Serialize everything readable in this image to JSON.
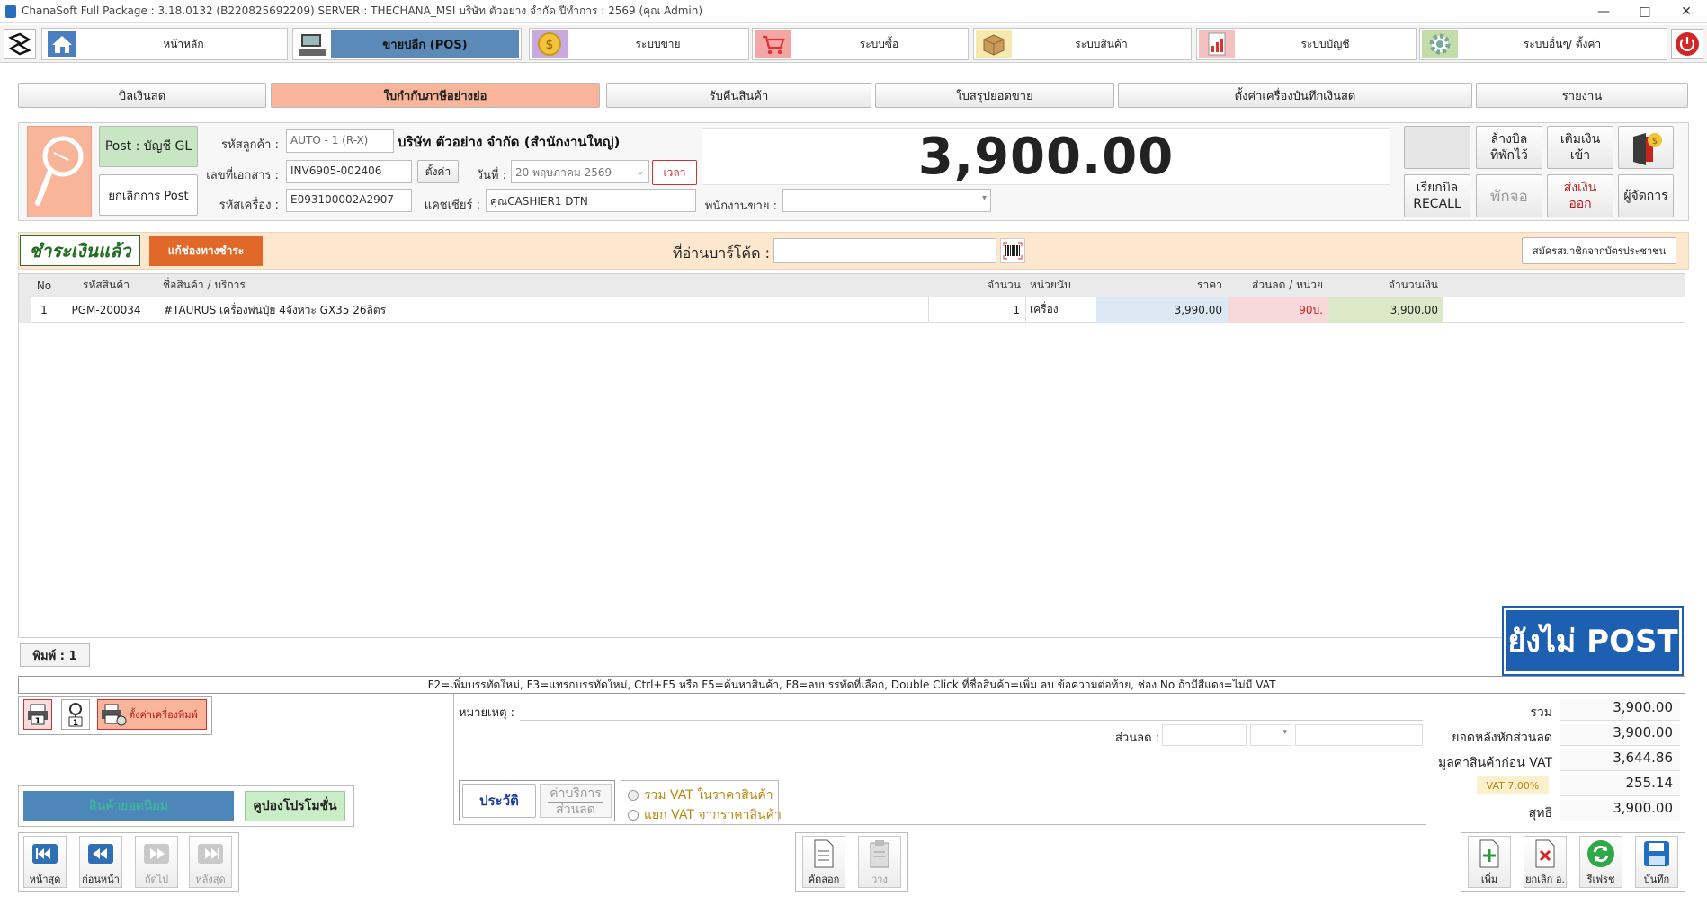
{
  "window": {
    "title": "ChanaSoft Full Package : 3.18.0132 (B220825692209) SERVER : THECHANA_MSI บริษัท ตัวอย่าง จำกัด ปีทำการ : 2569 (คุณ Admin)",
    "controls": [
      "—",
      "□",
      "✕"
    ]
  },
  "menu": {
    "items": [
      {
        "label": "หน้าหลัก",
        "icon": "home-icon"
      },
      {
        "label": "ขายปลีก (POS)",
        "icon": "pos-terminal-icon",
        "active": true
      },
      {
        "label": "ระบบขาย",
        "icon": "coin-icon"
      },
      {
        "label": "ระบบซื้อ",
        "icon": "cart-icon"
      },
      {
        "label": "ระบบสินค้า",
        "icon": "box-icon"
      },
      {
        "label": "ระบบบัญชี",
        "icon": "report-icon"
      },
      {
        "label": "ระบบอื่นๆ/ ตั้งค่า",
        "icon": "gear-icon"
      }
    ]
  },
  "subnav": {
    "tabs": [
      "บิลเงินสด",
      "ใบกำกับภาษีอย่างย่อ",
      "รับคืนสินค้า",
      "ใบสรุปยอดขาย",
      "ตั้งค่าเครื่องบันทึกเงินสด",
      "รายงาน"
    ],
    "active_index": 1
  },
  "header": {
    "post_gl": "Post : บัญชี GL",
    "cancel_post": "ยกเลิกการ Post",
    "customer_label": "รหัสลูกค้า :",
    "customer_code": "AUTO - 1 (R-X)",
    "customer_name": "บริษัท ตัวอย่าง จำกัด (สำนักงานใหญ่)",
    "doc_label": "เลขที่เอกสาร :",
    "doc_no": "INV6905-002406",
    "set_btn": "ตั้งค่า",
    "date_label": "วันที่ :",
    "date_value": "20  พฤษภาคม   2569",
    "time_btn": "เวลา",
    "machine_label": "รหัสเครื่อง :",
    "machine_code": "E093100002A2907",
    "cashier_label": "แคชเชียร์ :",
    "cashier_value": "คุณCASHIER1 DTN",
    "sales_label": "พนักงานขาย :",
    "sales_value": "",
    "total": "3,900.00"
  },
  "right_buttons": {
    "clear_held": "ล้างบิล\nที่พักไว้",
    "cash_in": "เติมเงิน\nเข้า",
    "recall": "เรียกบิล\nRECALL",
    "hold": "พักจอ",
    "cash_out": "ส่งเงิน\nออก",
    "manager": "ผู้จัดการ"
  },
  "paybar": {
    "status": "ชำระเงินแล้ว",
    "fix_payment": "แก้ช่องทางชำระ",
    "barcode_label": "ที่อ่านบาร์โค้ด :",
    "barcode_value": "",
    "member_btn": "สมัครสมาชิกจากบัตรประชาชน"
  },
  "table": {
    "columns": [
      "No",
      "รหัสสินค้า",
      "ชื่อสินค้า / บริการ",
      "จำนวน",
      "หน่วยนับ",
      "ราคา",
      "ส่วนลด / หน่วย",
      "จำนวนเงิน"
    ],
    "rows": [
      {
        "no": "1",
        "code": "PGM-200034",
        "name": "#TAURUS เครื่องพ่นปุ๋ย 4จังหวะ GX35 26ลิตร",
        "qty": "1",
        "unit": "เครื่อง",
        "price": "3,990.00",
        "discount": "90บ.",
        "amount": "3,900.00"
      }
    ]
  },
  "not_posted": "ยังไม่ POST",
  "print_count": "พิมพ์ : 1",
  "hint": "F2=เพิ่มบรรทัดใหม่,   F3=แทรกบรรทัดใหม่,   Ctrl+F5 หรือ F5=ค้นหาสินค้า,   F8=ลบบรรทัดที่เลือก,   Double Click ที่ชื่อสินค้า=เพิ่ม ลบ ข้อความต่อท้าย,   ช่อง No ถ้ามีสีแดง=ไม่มี VAT",
  "printer_setup": "ตั้งค่าเครื่องพิมพ์",
  "promo": {
    "popular": "สินค้ายอดนิยม",
    "coupon": "คูปองโปรโมชั่น"
  },
  "remarks": {
    "note_label": "หมายเหตุ :",
    "note_value": "",
    "discount_label": "ส่วนลด :",
    "history_btn": "ประวัติ",
    "service_line1": "ค่าบริการ",
    "service_line2": "ส่วนลด",
    "vat_included": "รวม VAT ในราคาสินค้า",
    "vat_excluded": "แยก VAT จากราคาสินค้า"
  },
  "summary": [
    {
      "label": "รวม",
      "value": "3,900.00"
    },
    {
      "label": "ยอดหลังหักส่วนลด",
      "value": "3,900.00"
    },
    {
      "label": "มูลค่าสินค้าก่อน VAT",
      "value": "3,644.86"
    },
    {
      "label": "VAT 7.00%",
      "value": "255.14"
    },
    {
      "label": "สุทธิ",
      "value": "3,900.00"
    }
  ],
  "nav": {
    "first": "หน้าสุด",
    "prev": "ก่อนหน้า",
    "next": "ถัดไป",
    "last": "หลังสุด"
  },
  "clip": {
    "copy": "คัดลอก",
    "paste": "วาง"
  },
  "actions": {
    "add": "เพิ่ม",
    "cancel": "ยกเลิก อ.",
    "refresh": "รีเฟรช",
    "save": "บันทึก"
  },
  "colors": {
    "active_menu": "#5b8ab8",
    "active_tab": "#f8b59a",
    "paybar_bg": "#fde7cf",
    "not_posted_bg": "#1d5fb1"
  }
}
